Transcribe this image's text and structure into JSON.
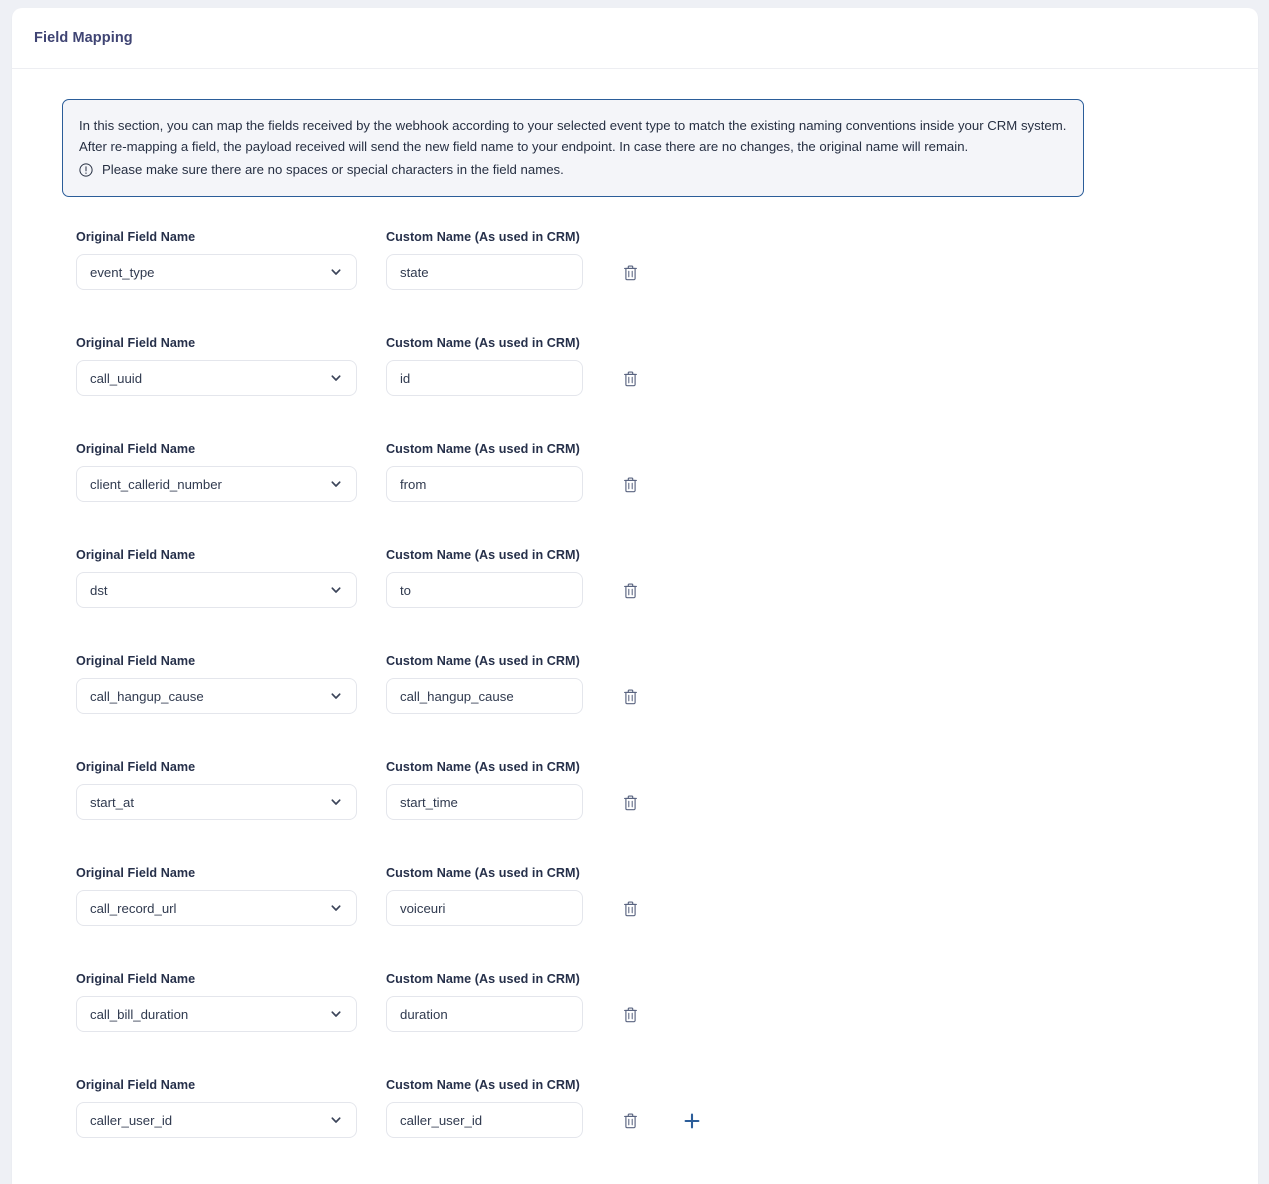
{
  "card": {
    "title": "Field Mapping"
  },
  "banner": {
    "paragraph": "In this section, you can map the fields received by the webhook according to your selected event type to match the existing naming conventions inside your CRM system. After re-mapping a field, the payload received will send the new field name to your endpoint. In case there are no changes, the original name will remain.",
    "note": "Please make sure there are no spaces or special characters in the field names.",
    "note_icon": "info-circle-icon",
    "border_color": "#2b5d99",
    "background_color": "#f4f5f9"
  },
  "labels": {
    "original_field_name": "Original Field Name",
    "custom_name": "Custom Name (As used in CRM)"
  },
  "actions": {
    "delete_icon": "trash-icon",
    "add_icon": "plus-icon",
    "add_color": "#2b5d99",
    "delete_color": "#5a6480"
  },
  "rows": [
    {
      "original": "event_type",
      "custom": "state",
      "has_add": false
    },
    {
      "original": "call_uuid",
      "custom": "id",
      "has_add": false
    },
    {
      "original": "client_callerid_number",
      "custom": "from",
      "has_add": false
    },
    {
      "original": "dst",
      "custom": "to",
      "has_add": false
    },
    {
      "original": "call_hangup_cause",
      "custom": "call_hangup_cause",
      "has_add": false
    },
    {
      "original": "start_at",
      "custom": "start_time",
      "has_add": false
    },
    {
      "original": "call_record_url",
      "custom": "voiceuri",
      "has_add": false
    },
    {
      "original": "call_bill_duration",
      "custom": "duration",
      "has_add": false
    },
    {
      "original": "caller_user_id",
      "custom": "caller_user_id",
      "has_add": true
    }
  ]
}
